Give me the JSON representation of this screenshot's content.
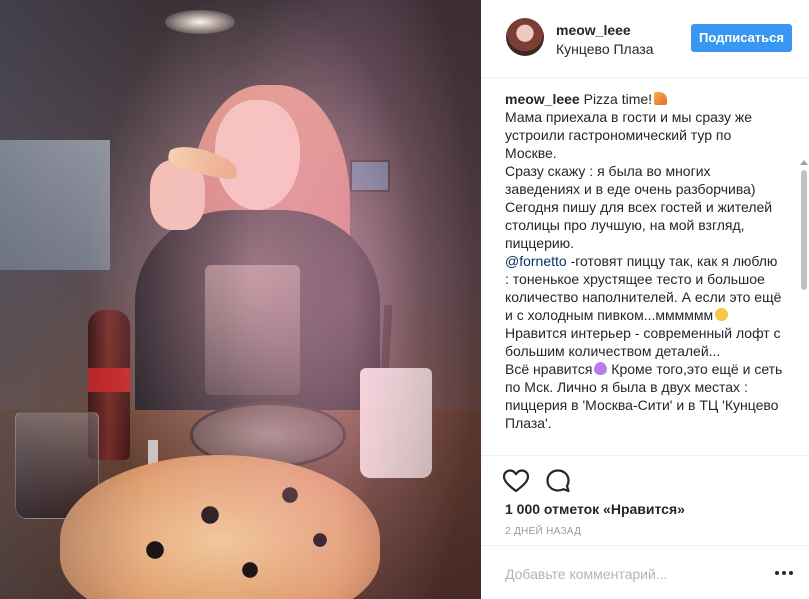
{
  "post": {
    "photo_alt": "",
    "author": {
      "username": "meow_leee",
      "location": "Кунцево Плаза",
      "follow_label": "Подписаться"
    },
    "caption": {
      "username": "meow_leee",
      "title": "Pizza time!",
      "paragraphs": [
        "Мама приехала в гости и мы сразу же устроили гастрономический тур по Москве.",
        "Сразу скажу : я была во многих заведениях и в еде очень разборчива)",
        "Сегодня пишу для всех гостей и жителей столицы про лучшую, на мой взгляд, пиццерию."
      ],
      "mention": "@fornetto",
      "mention_text": " -готовят пиццу так, как я люблю : тоненькое хрустящее тесто и большое количество наполнителей. А если это ещё и с холодным пивком...мммммм",
      "interior_text": "Нравится интерьер - современный лофт с большим количеством деталей...",
      "all_like_text": "Всё нравится",
      "chain_text": " Кроме того,это ещё и сеть по Мск. Лично я была в двух местах : пиццерия в 'Москва-Сити' и в ТЦ 'Кунцево Плаза'."
    },
    "emojis": {
      "title": "pizza-emoji",
      "mention": "relieved-face-emoji",
      "all_like": "purple-heart-emoji"
    },
    "likes_text": "1 000 отметок «Нравится»",
    "time_ago": "2 ДНЕЙ НАЗАД",
    "comment_placeholder": "Добавьте комментарий...",
    "colors": {
      "accent": "#3897f0",
      "text": "#262626",
      "muted": "#999999",
      "mention": "#003569",
      "border": "#efefef"
    }
  }
}
